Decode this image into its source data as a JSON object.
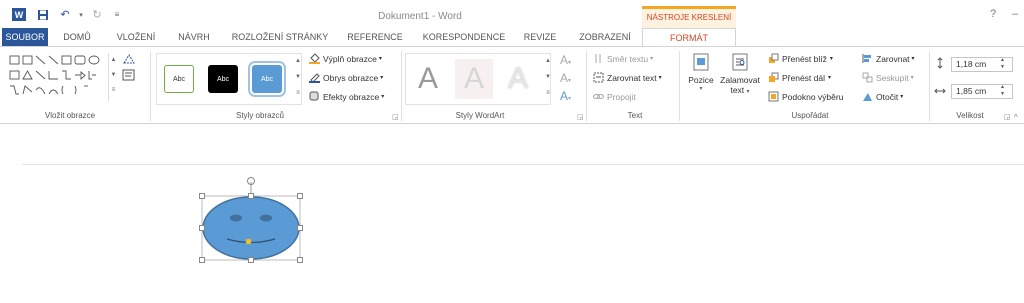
{
  "window": {
    "title": "Dokument1 - Word",
    "context_group": "NÁSTROJE KRESLENÍ",
    "help": "?",
    "minimize": "–",
    "restore": "▭"
  },
  "tabs": [
    "SOUBOR",
    "DOMŮ",
    "VLOŽENÍ",
    "NÁVRH",
    "ROZLOŽENÍ STRÁNKY",
    "REFERENCE",
    "KORESPONDENCE",
    "REVIZE",
    "ZOBRAZENÍ",
    "FORMÁT"
  ],
  "groups": {
    "insert_shapes": {
      "label": "Vložit obrazce"
    },
    "shape_styles": {
      "label": "Styly obrazců",
      "samples": [
        "Abc",
        "Abc",
        "Abc"
      ],
      "fill": "Výplň obrazce",
      "outline": "Obrys obrazce",
      "effects": "Efekty obrazce"
    },
    "wordart": {
      "label": "Styly WordArt",
      "letter": "A"
    },
    "text": {
      "label": "Text",
      "direction": "Směr textu",
      "align": "Zarovnat text",
      "link": "Propojit"
    },
    "arrange": {
      "label": "Uspořádat",
      "position": "Pozice",
      "wrap_line1": "Zalamovat",
      "wrap_line2": "text",
      "bring_forward": "Přenést blíž",
      "send_backward": "Přenést dál",
      "selection_pane": "Podokno výběru",
      "align": "Zarovnat",
      "group": "Seskupit",
      "rotate": "Otočit"
    },
    "size": {
      "label": "Velikost",
      "height": "1,18 cm",
      "width": "1,85 cm"
    }
  },
  "colors": {
    "accent": "#2b579a",
    "context": "#d24726",
    "shape_fill": "#5b9bd5",
    "shape_stroke": "#41719c"
  }
}
